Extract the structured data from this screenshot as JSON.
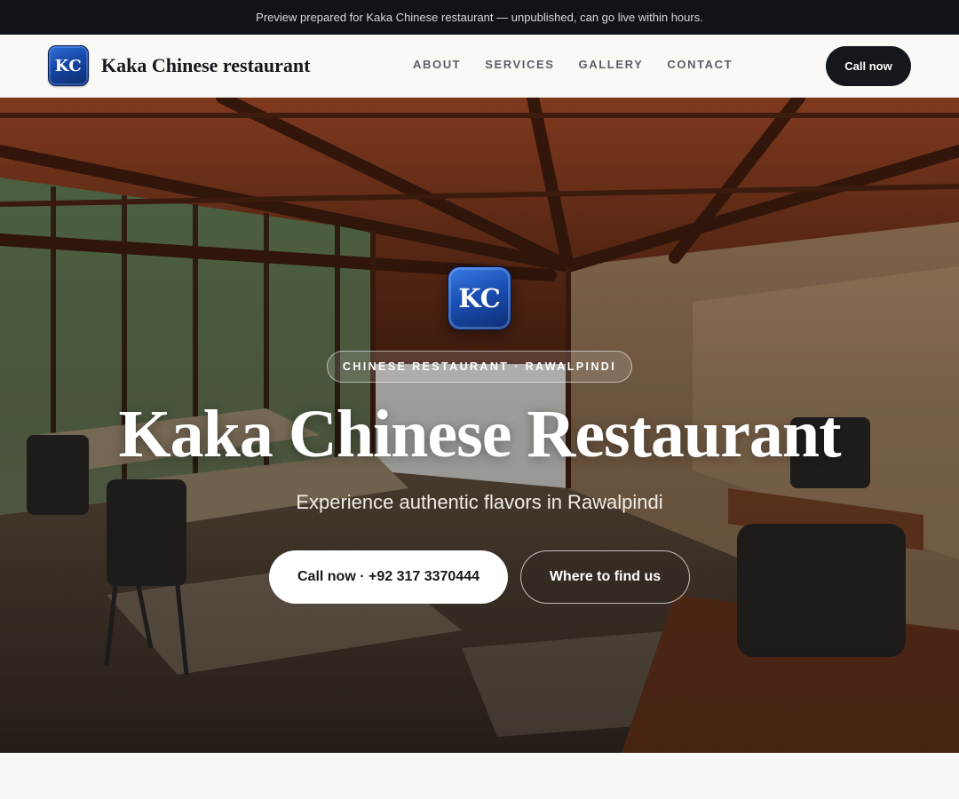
{
  "preview_bar": {
    "text": "Preview prepared for Kaka Chinese restaurant — unpublished, can go live within hours."
  },
  "header": {
    "logo_text": "KC",
    "brand_name": "Kaka Chinese restaurant",
    "nav": [
      "ABOUT",
      "SERVICES",
      "GALLERY",
      "CONTACT"
    ],
    "cta_label": "Call now"
  },
  "hero": {
    "logo_text": "KC",
    "tagline": "CHINESE RESTAURANT · RAWALPINDI",
    "title": "Kaka Chinese Restaurant",
    "subtitle": "Experience authentic flavors in Rawalpindi",
    "primary_button": "Call now · +92 317 3370444",
    "secondary_button": "Where to find us"
  },
  "colors": {
    "dark": "#111318",
    "brand_blue": "#1747a6",
    "wood": "#8a3b1f",
    "background": "#faf8f4"
  }
}
